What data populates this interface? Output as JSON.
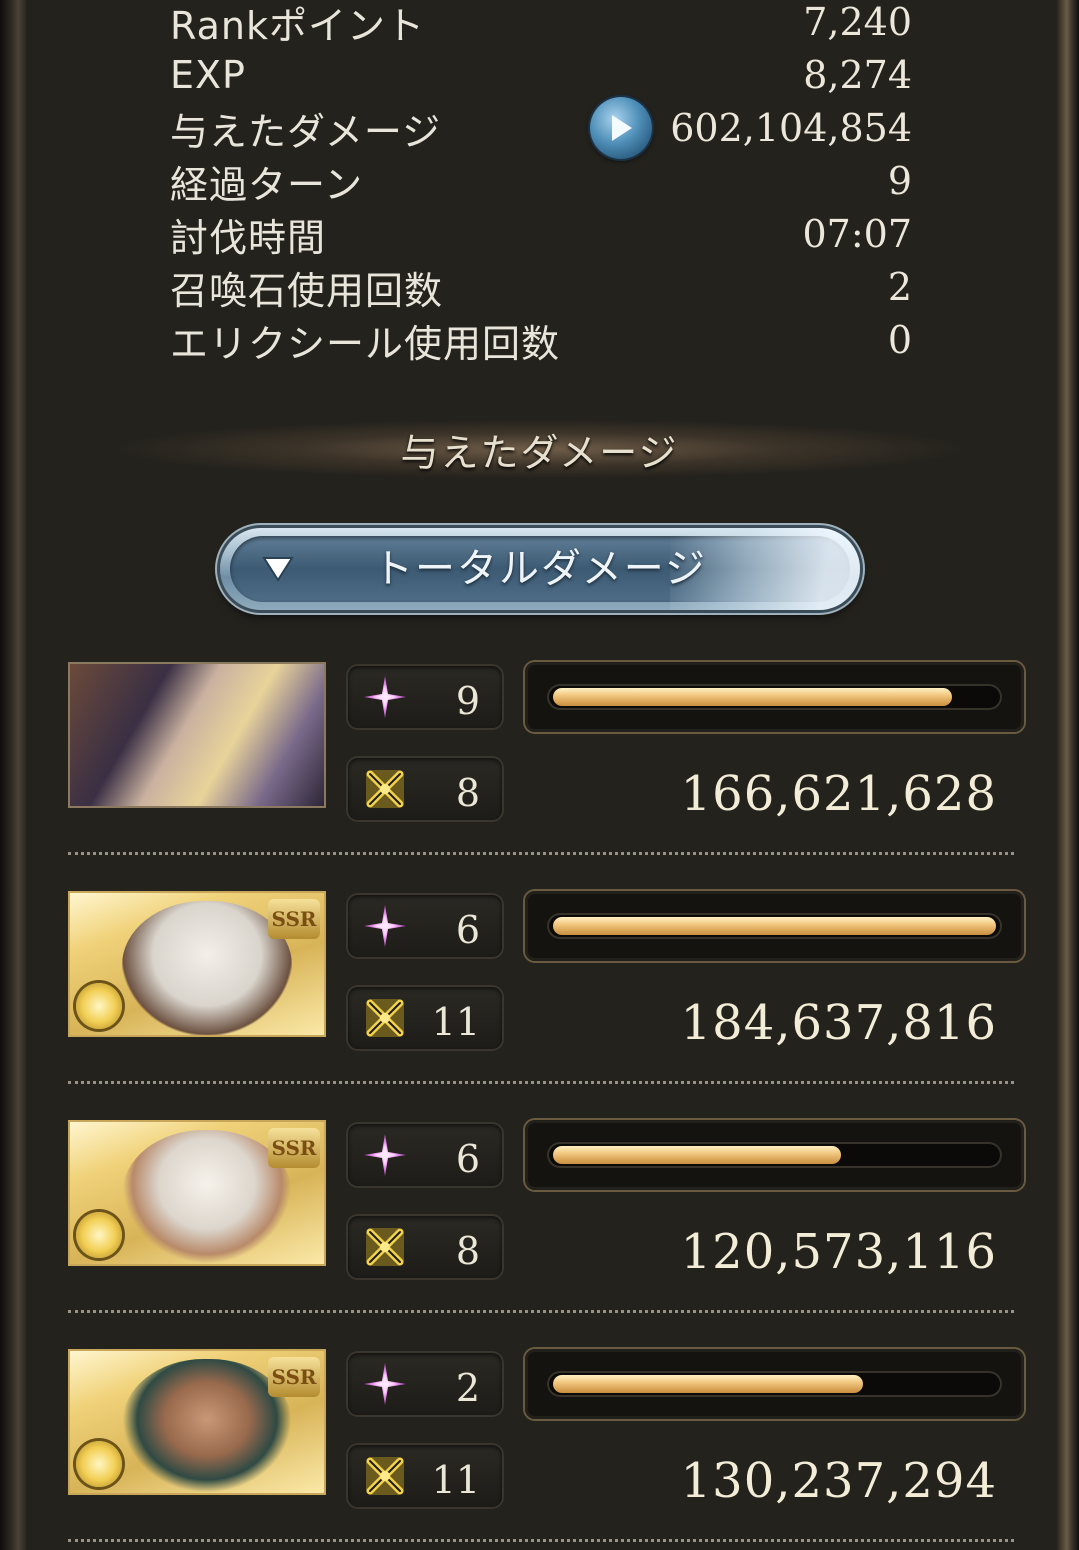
{
  "stats": [
    {
      "label": "Rankポイント",
      "value": "7,240"
    },
    {
      "label": "EXP",
      "value": "8,274"
    },
    {
      "label": "与えたダメージ",
      "value": "602,104,854"
    },
    {
      "label": "経過ターン",
      "value": "9"
    },
    {
      "label": "討伐時間",
      "value": "07:07"
    },
    {
      "label": "召喚石使用回数",
      "value": "2"
    },
    {
      "label": "エリクシール使用回数",
      "value": "0"
    }
  ],
  "section": {
    "title": "与えたダメージ"
  },
  "dropdown": {
    "label": "トータルダメージ"
  },
  "characters": [
    {
      "skill_count": "9",
      "ougi_count": "8",
      "damage": "166,621,628",
      "bar_fraction": 0.9,
      "rarity": ""
    },
    {
      "skill_count": "6",
      "ougi_count": "11",
      "damage": "184,637,816",
      "bar_fraction": 1.0,
      "rarity": "SSR"
    },
    {
      "skill_count": "6",
      "ougi_count": "8",
      "damage": "120,573,116",
      "bar_fraction": 0.65,
      "rarity": "SSR"
    },
    {
      "skill_count": "2",
      "ougi_count": "11",
      "damage": "130,237,294",
      "bar_fraction": 0.7,
      "rarity": "SSR"
    }
  ],
  "icons": {
    "play": "play-icon",
    "dropdown_arrow": "triangle-down-icon",
    "skill": "sparkle-icon",
    "ougi": "crossed-swords-icon",
    "element": "light-element-icon"
  },
  "colors": {
    "bar_fill": "#f0c37a",
    "skill_icon": "#e07ae6",
    "ougi_icon": "#e8c64a",
    "play_button": "#4f8fb8"
  }
}
